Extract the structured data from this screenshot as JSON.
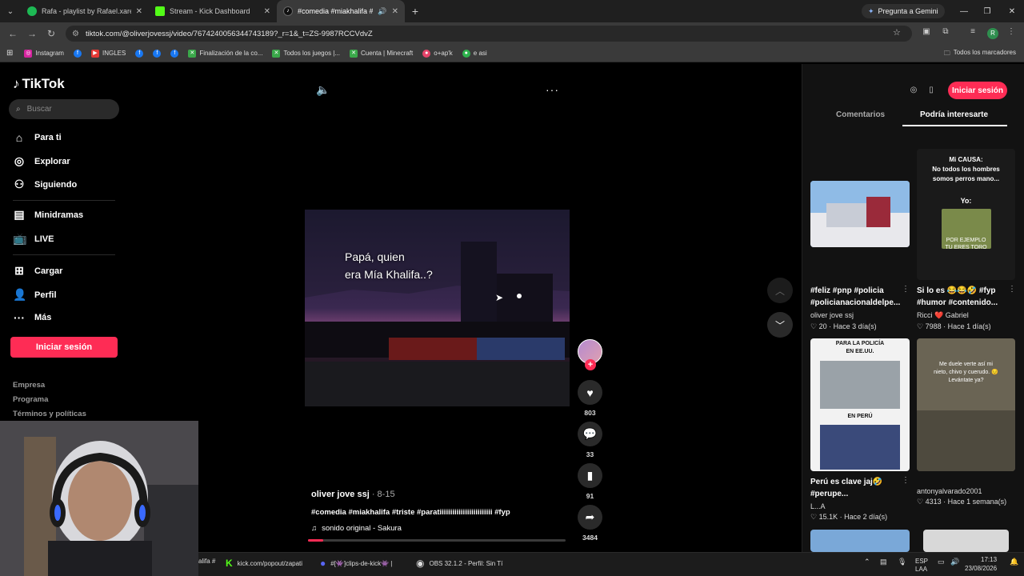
{
  "browser": {
    "tabs": [
      {
        "title": "Rafa - playlist by Rafael.xared |",
        "color": "#1db954",
        "active": false
      },
      {
        "title": "Stream - Kick Dashboard",
        "color": "#53fc18",
        "active": false
      },
      {
        "title": "#comedia #miakhalifa #triste",
        "color": "#ffffff",
        "active": true
      }
    ],
    "new_tab": "+",
    "gemini": "Pregunta a Gemini",
    "url": "tiktok.com/@oliverjovessj/video/7674240056344743189?_r=1&_t=ZS-9987RCCVdvZ",
    "profile_initial": "R",
    "bookmarks": [
      {
        "label": "Instagram",
        "color": "#d6249f"
      },
      {
        "label": "",
        "color": "#1877f2"
      },
      {
        "label": "INGLES",
        "color": "#e53935"
      },
      {
        "label": "",
        "color": "#1877f2"
      },
      {
        "label": "",
        "color": "#1877f2"
      },
      {
        "label": "",
        "color": "#1877f2"
      },
      {
        "label": "Finalización de la co...",
        "color": "#3aa84a"
      },
      {
        "label": "Todos los juegos |...",
        "color": "#3aa84a"
      },
      {
        "label": "Cuenta | Minecraft",
        "color": "#3aa84a"
      },
      {
        "label": "o+ap'k",
        "color": "#e6446a"
      },
      {
        "label": "e asi",
        "color": "#2eb34d"
      }
    ],
    "all_bookmarks": "Todos los marcadores"
  },
  "sidebar": {
    "logo": "TikTok",
    "search_placeholder": "Buscar",
    "nav": [
      {
        "label": "Para ti",
        "icon": "home-icon"
      },
      {
        "label": "Explorar",
        "icon": "compass-icon"
      },
      {
        "label": "Siguiendo",
        "icon": "following-icon"
      },
      {
        "label": "Minidramas",
        "icon": "film-icon"
      },
      {
        "label": "LIVE",
        "icon": "live-icon"
      },
      {
        "label": "Cargar",
        "icon": "upload-icon"
      },
      {
        "label": "Perfil",
        "icon": "profile-icon"
      },
      {
        "label": "Más",
        "icon": "more-icon"
      }
    ],
    "login": "Iniciar sesión",
    "footer": [
      "Empresa",
      "Programa",
      "Términos y políticas"
    ]
  },
  "video": {
    "overlay_line1": "Papá, quien",
    "overlay_line2": "era Mía Khalifa..?",
    "author": "oliver jove ssj",
    "date": " · 8-15",
    "tags": "#comedia #miakhalifa #triste #paratiiiiiiiiiiiiiiiiiiiiiiiii #fyp",
    "sound": "sonido original - Sakura",
    "progress": 0.06,
    "likes": "803",
    "comments": "33",
    "saves": "91",
    "shares": "3484"
  },
  "right_panel": {
    "login": "Iniciar sesión",
    "tabs": [
      "Comentarios",
      "Podría interesarte"
    ],
    "cards": [
      {
        "title1": "#feliz #pnp #policia",
        "title2": "#policianacionaldelpe...",
        "author": "oliver jove ssj",
        "likes": "20",
        "time": "Hace 3 día(s)"
      },
      {
        "thumb_text1": "Mi CAUSA:",
        "thumb_text2": "No todos los hombres",
        "thumb_text3": "somos perros mano...",
        "thumb_text4": "Yo:",
        "thumb_text5": "POR EJEMPLO",
        "thumb_text6": "TU ERES TORO",
        "title1": "Si lo es 😂😂🤣 #fyp",
        "title2": "#humor #contenido...",
        "author": "Ricci ❤️ Gabriel",
        "likes": "7988",
        "time": "Hace 1 día(s)"
      },
      {
        "thumb_text1": "PARA LA POLICÍA",
        "thumb_text2": "EN EE.UU.",
        "thumb_text3": "EN PERÚ",
        "title1": "Perú es clave jaj🤣",
        "title2": "#perupe...",
        "author": "L...A",
        "likes": "15.1K",
        "time": "Hace 2 día(s)"
      },
      {
        "thumb_text1": "Me duele verte así mi",
        "thumb_text2": "nieto, chivo y cuerudo. 😔",
        "thumb_text3": "Levántate ya?",
        "author": "antonyalvarado2001",
        "likes": "4313",
        "time": "Hace 1 semana(s)"
      }
    ]
  },
  "taskbar": {
    "item1": "alifa #",
    "item2": "kick.com/popout/zapati",
    "item3": "#[👾]clips-de-kick👾 |",
    "item4": "OBS 32.1.2 - Perfil: Sin Tí",
    "lang1": "ESP",
    "lang2": "LAA",
    "time": "17:13",
    "date": "23/08/2026"
  }
}
